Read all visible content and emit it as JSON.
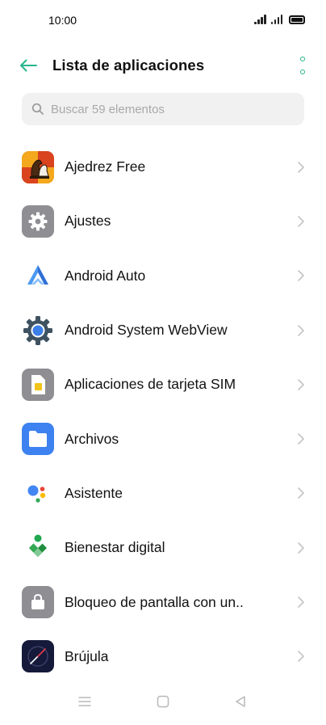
{
  "status_bar": {
    "time": "10:00"
  },
  "header": {
    "title": "Lista de aplicaciones"
  },
  "search": {
    "placeholder": "Buscar 59 elementos"
  },
  "apps": [
    {
      "label": "Ajedrez Free",
      "icon": "chess-app-icon"
    },
    {
      "label": "Ajustes",
      "icon": "settings-gear-icon"
    },
    {
      "label": "Android Auto",
      "icon": "android-auto-icon"
    },
    {
      "label": "Android System WebView",
      "icon": "webview-gear-icon"
    },
    {
      "label": "Aplicaciones de tarjeta SIM",
      "icon": "sim-card-icon"
    },
    {
      "label": "Archivos",
      "icon": "folder-icon"
    },
    {
      "label": "Asistente",
      "icon": "assistant-icon"
    },
    {
      "label": "Bienestar digital",
      "icon": "digital-wellbeing-icon"
    },
    {
      "label": "Bloqueo de pantalla con un..",
      "icon": "lock-bag-icon"
    },
    {
      "label": "Brújula",
      "icon": "compass-icon"
    }
  ],
  "colors": {
    "accent": "#27b58b",
    "search_bg": "#f1f1f1",
    "chevron": "#c4c4c4"
  }
}
